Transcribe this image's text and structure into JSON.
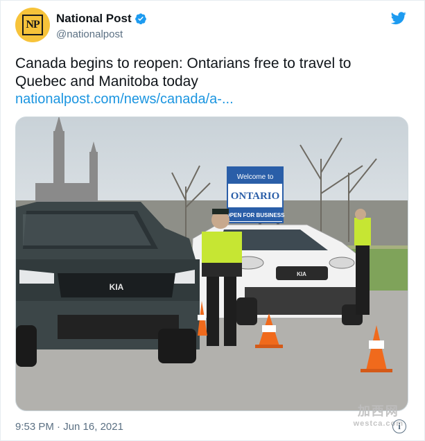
{
  "author": {
    "name": "National Post",
    "handle": "@nationalpost",
    "avatar_initials": "NP",
    "verified": true
  },
  "tweet": {
    "text_line1": "Canada begins to reopen: Ontarians free to travel to",
    "text_line2": "Quebec and  Manitoba today",
    "link": "nationalpost.com/news/canada/a-..."
  },
  "photo": {
    "sign_line1": "Welcome to",
    "sign_line2": "ONTARIO",
    "sign_line3": "OPEN FOR BUSINESS",
    "car_badge": "KIA",
    "car2_badge": "KIA"
  },
  "watermark": {
    "cn": "加西网",
    "en": "westca.com"
  },
  "meta": {
    "timestamp": "9:53 PM · Jun 16, 2021"
  },
  "colors": {
    "link": "#1b95e0",
    "twitter_blue": "#1d9bf0",
    "avatar_bg": "#f7c33a",
    "muted": "#5b7083"
  },
  "icons": [
    "verified-badge-icon",
    "twitter-bird-icon",
    "info-icon"
  ]
}
